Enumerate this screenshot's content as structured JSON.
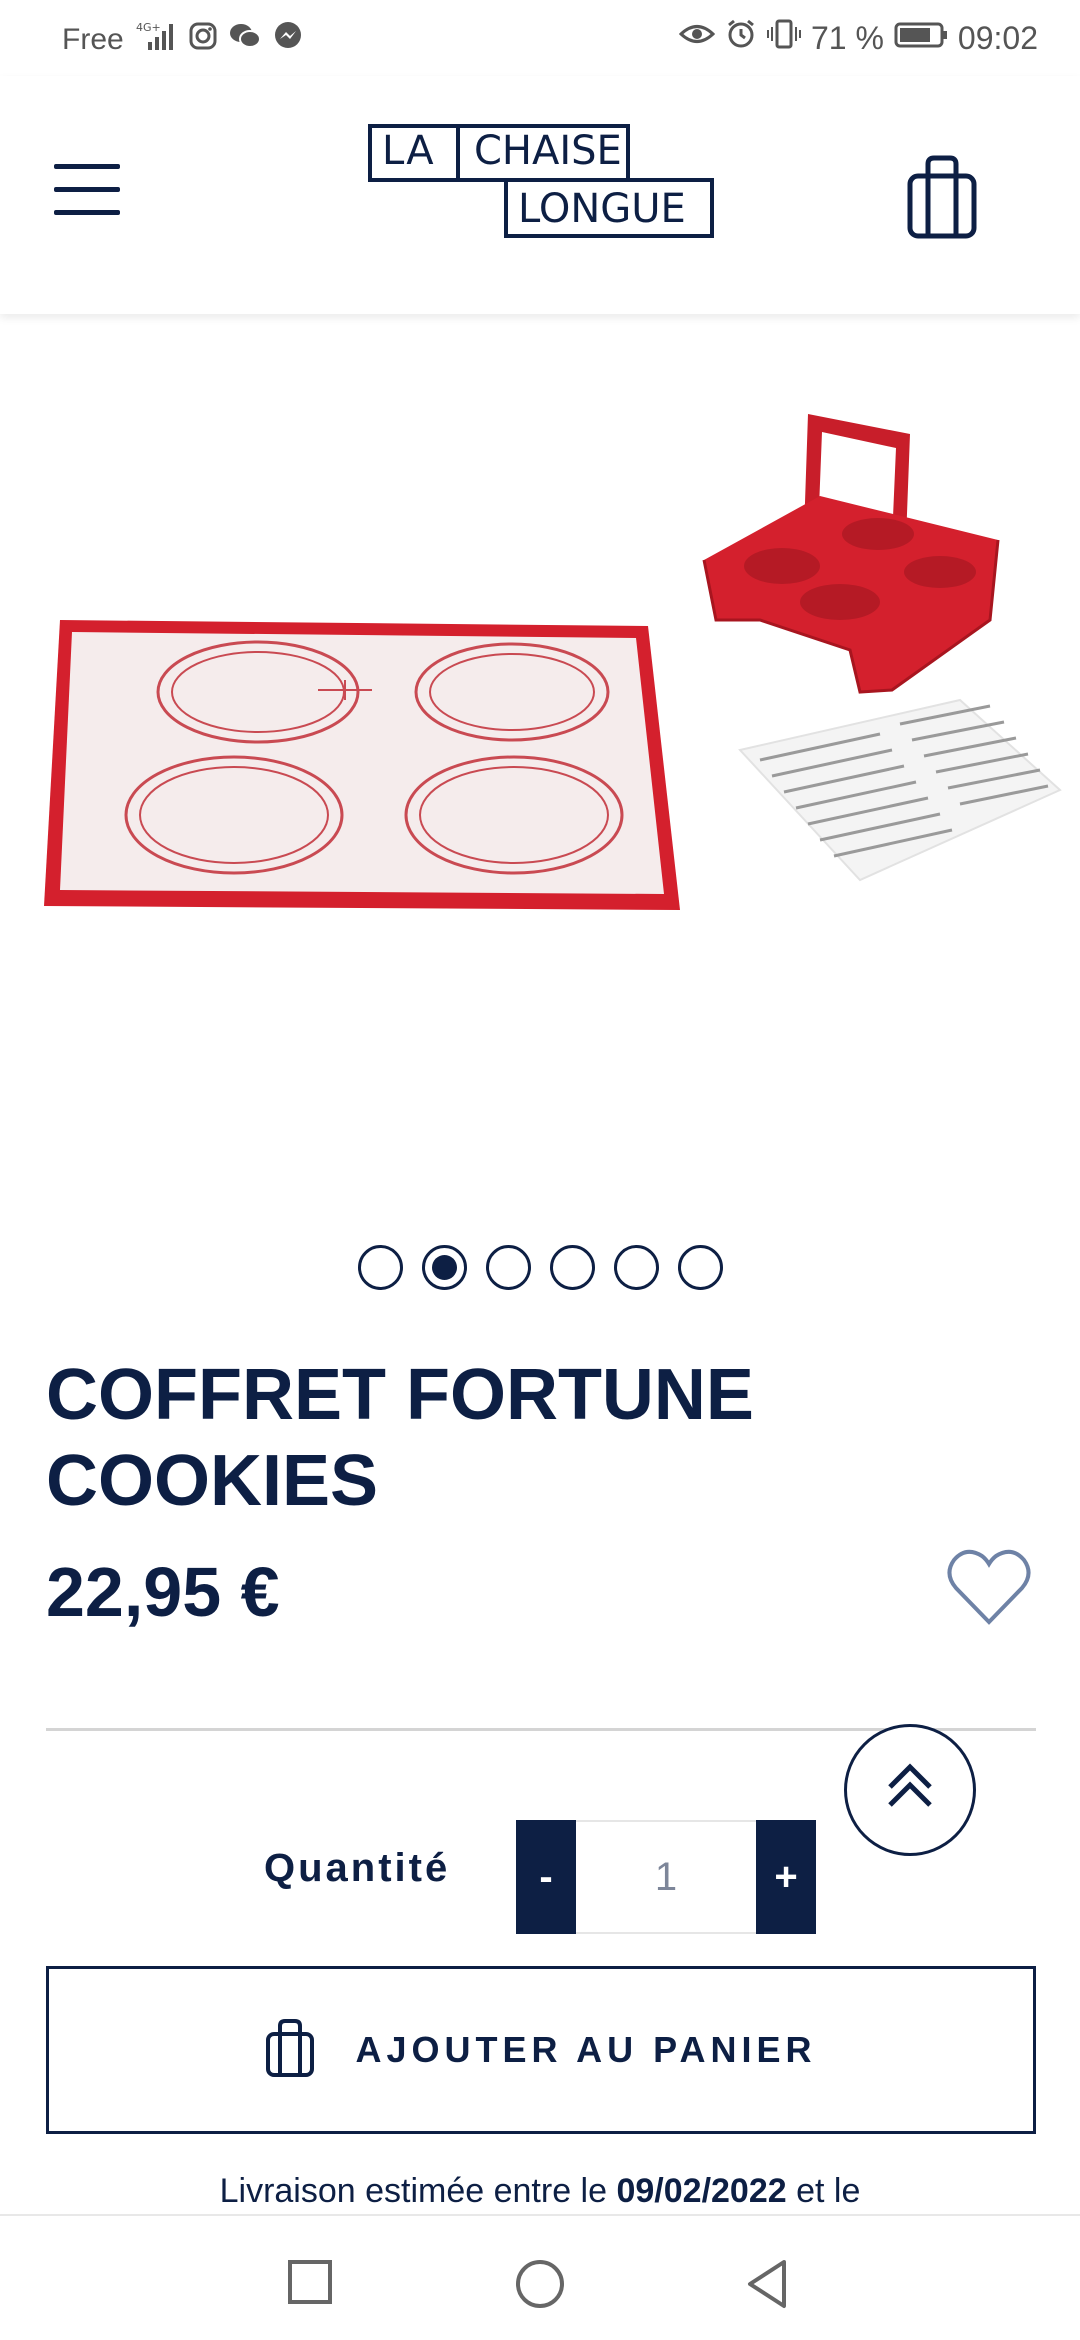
{
  "status_bar": {
    "carrier": "Free",
    "network": "4G+",
    "battery": "71 %",
    "time": "09:02"
  },
  "header": {
    "logo": {
      "word1": "LA",
      "word2": "CHAISE",
      "word3": "LONGUE"
    }
  },
  "carousel": {
    "total": 6,
    "active_index": 1
  },
  "product": {
    "title": "COFFRET FORTUNE COOKIES",
    "price": "22,95 €"
  },
  "quantity": {
    "label": "Quantité",
    "minus": "-",
    "value": "1",
    "plus": "+"
  },
  "add_to_cart": {
    "label": "AJOUTER AU PANIER"
  },
  "delivery": {
    "prefix": "Livraison estimée entre le",
    "date": "09/02/2022",
    "suffix": "et le"
  },
  "colors": {
    "navy": "#0d1f44",
    "red": "#d4202d"
  }
}
